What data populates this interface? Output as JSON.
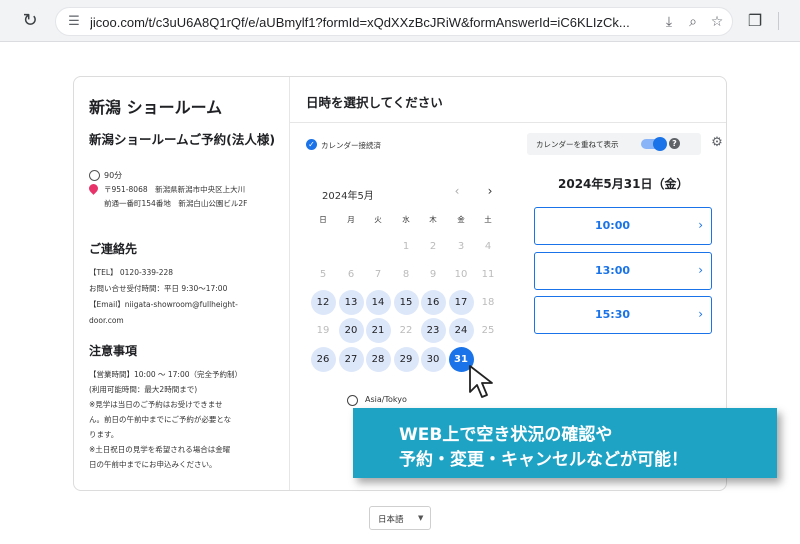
{
  "browser": {
    "url": "jicoo.com/t/c3uU6A8Q1rQf/e/aUBmylf1?formId=xQdXXzBcJRiW&formAnswerId=iC6KLIzCk..."
  },
  "info": {
    "shop_title": "新潟 ショールーム",
    "event_title": "新潟ショールームご予約(法人様)",
    "duration": "90分",
    "address_line1": "〒951-8068　新潟県新潟市中央区上大川",
    "address_line2": "前通一番町154番地　新潟白山公園ビル2F",
    "contact_heading": "ご連絡先",
    "contact_lines": [
      "【TEL】 0120-339-228",
      "お問い合せ受付時間：平日 9:30～17:00",
      "【Email】niigata-showroom@fullheight-",
      "door.com"
    ],
    "notes_heading": "注意事項",
    "notes_lines": [
      "【営業時間】10:00 ～ 17:00（完全予約制）",
      "(利用可能時間：最大2時間まで)",
      "※見学は当日のご予約はお受けできませ",
      "ん。前日の午前中までにご予約が必要とな",
      "ります。",
      "※土日祝日の見学を希望される場合は金曜",
      "日の午前中までにお申込みください。"
    ]
  },
  "panel": {
    "title": "日時を選択してください",
    "calendar_linked_label": "カレンダー接続済",
    "overlay_label": "カレンダーを重ねて表示",
    "help_label": "?",
    "month_label": "2024年5月",
    "weekdays": [
      "日",
      "月",
      "火",
      "水",
      "木",
      "金",
      "土"
    ],
    "days": [
      {
        "d": "1",
        "state": "off"
      },
      {
        "d": "2",
        "state": "off"
      },
      {
        "d": "3",
        "state": "off"
      },
      {
        "d": "4",
        "state": "off"
      },
      {
        "d": "5",
        "state": "off"
      },
      {
        "d": "6",
        "state": "off"
      },
      {
        "d": "7",
        "state": "off"
      },
      {
        "d": "8",
        "state": "off"
      },
      {
        "d": "9",
        "state": "off"
      },
      {
        "d": "10",
        "state": "off"
      },
      {
        "d": "11",
        "state": "off"
      },
      {
        "d": "12",
        "state": "avail"
      },
      {
        "d": "13",
        "state": "avail"
      },
      {
        "d": "14",
        "state": "avail"
      },
      {
        "d": "15",
        "state": "avail"
      },
      {
        "d": "16",
        "state": "avail"
      },
      {
        "d": "17",
        "state": "avail"
      },
      {
        "d": "18",
        "state": "off"
      },
      {
        "d": "19",
        "state": "off"
      },
      {
        "d": "20",
        "state": "avail"
      },
      {
        "d": "21",
        "state": "avail"
      },
      {
        "d": "22",
        "state": "off"
      },
      {
        "d": "23",
        "state": "avail"
      },
      {
        "d": "24",
        "state": "avail"
      },
      {
        "d": "25",
        "state": "off"
      },
      {
        "d": "26",
        "state": "avail"
      },
      {
        "d": "27",
        "state": "avail"
      },
      {
        "d": "28",
        "state": "avail"
      },
      {
        "d": "29",
        "state": "avail"
      },
      {
        "d": "30",
        "state": "avail"
      },
      {
        "d": "31",
        "state": "selected"
      }
    ],
    "timezone": "Asia/Tokyo",
    "selected_date_heading": "2024年5月31日（金）",
    "time_slots": [
      "10:00",
      "13:00",
      "15:30"
    ]
  },
  "callout": {
    "line1": "WEB上で空き状況の確認や",
    "line2": "予約・変更・キャンセルなどが可能！"
  },
  "footer": {
    "language": "日本語"
  },
  "colors": {
    "accent": "#1a73e8",
    "available_day": "#dde7fa",
    "callout_bg": "#1fa3c5",
    "pin": "#e8336a"
  }
}
